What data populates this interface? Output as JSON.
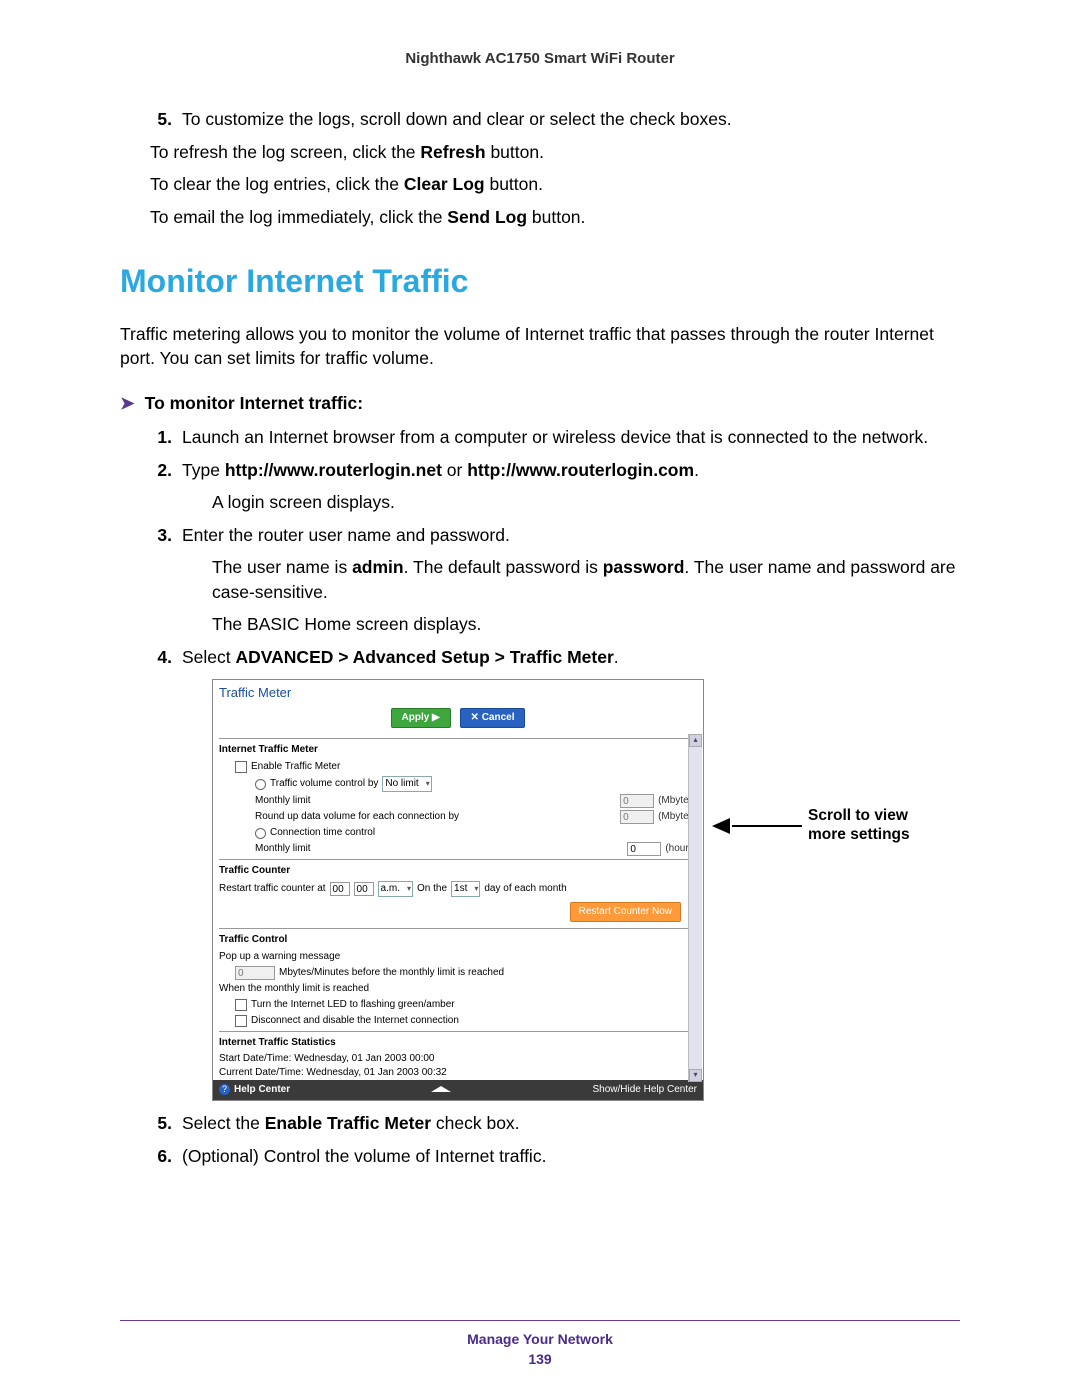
{
  "header": {
    "title": "Nighthawk AC1750 Smart WiFi Router"
  },
  "top": {
    "step5_num": "5.",
    "step5_text": "To customize the logs, scroll down and clear or select the check boxes.",
    "refresh_pre": "To refresh the log screen, click the ",
    "refresh_bold": "Refresh",
    "refresh_post": " button.",
    "clear_pre": "To clear the log entries, click the ",
    "clear_bold": "Clear Log",
    "clear_post": " button.",
    "email_pre": "To email the log immediately, click the ",
    "email_bold": "Send Log",
    "email_post": " button."
  },
  "section_heading": "Monitor Internet Traffic",
  "intro": "Traffic metering allows you to monitor the volume of Internet traffic that passes through the router Internet port. You can set limits for traffic volume.",
  "task_arrow": "➤",
  "task_title": "To monitor Internet traffic:",
  "steps": {
    "n1": "1.",
    "t1": "Launch an Internet browser from a computer or wireless device that is connected to the network.",
    "n2": "2.",
    "t2_pre": "Type ",
    "t2_b1": "http://www.routerlogin.net",
    "t2_mid": " or ",
    "t2_b2": "http://www.routerlogin.com",
    "t2_post": ".",
    "t2_p2": "A login screen displays.",
    "n3": "3.",
    "t3": "Enter the router user name and password.",
    "t3_p2a": "The user name is ",
    "t3_b1": "admin",
    "t3_p2b": ". The default password is ",
    "t3_b2": "password",
    "t3_p2c": ". The user name and password are case-sensitive.",
    "t3_p3": "The BASIC Home screen displays.",
    "n4": "4.",
    "t4_pre": "Select ",
    "t4_bold": "ADVANCED > Advanced Setup > Traffic Meter",
    "t4_post": ".",
    "n5": "5.",
    "t5_pre": "Select the ",
    "t5_bold": "Enable Traffic Meter",
    "t5_post": " check box.",
    "n6": "6.",
    "t6": "(Optional) Control the volume of Internet traffic."
  },
  "panel": {
    "title": "Traffic Meter",
    "apply": "Apply ▶",
    "cancel": "✕ Cancel",
    "sec1": "Internet Traffic Meter",
    "enable": "Enable Traffic Meter",
    "volctrl": "Traffic volume control by",
    "volctrl_sel": "No limit",
    "monthly_limit": "Monthly limit",
    "mbytes": "(Mbytes)",
    "roundup": "Round up data volume for each connection by",
    "conn_time": "Connection time control",
    "monthly_limit2": "Monthly limit",
    "hours": "(hours)",
    "val0": "0",
    "sec2": "Traffic Counter",
    "restart_at": "Restart traffic counter at",
    "h00": "00",
    "m00": "00",
    "am": "a.m.",
    "onthe": "On the",
    "first": "1st",
    "dayof": "day of each month",
    "restart_btn": "Restart Counter Now",
    "sec3": "Traffic Control",
    "popwarn": "Pop up a warning message",
    "popwarn2": "Mbytes/Minutes before the monthly limit is reached",
    "whenlimit": "When the monthly limit is reached",
    "led": "Turn the Internet LED to flashing green/amber",
    "disconnect": "Disconnect and disable the Internet connection",
    "sec4": "Internet Traffic Statistics",
    "start_dt": "Start Date/Time: Wednesday, 01 Jan 2003 00:00",
    "curr_dt": "Current Date/Time: Wednesday, 01 Jan 2003 00:32",
    "help": "Help Center",
    "showhide": "Show/Hide Help Center"
  },
  "callout": {
    "line1": "Scroll to view",
    "line2": "more settings"
  },
  "footer": {
    "chapter": "Manage Your Network",
    "page": "139"
  }
}
